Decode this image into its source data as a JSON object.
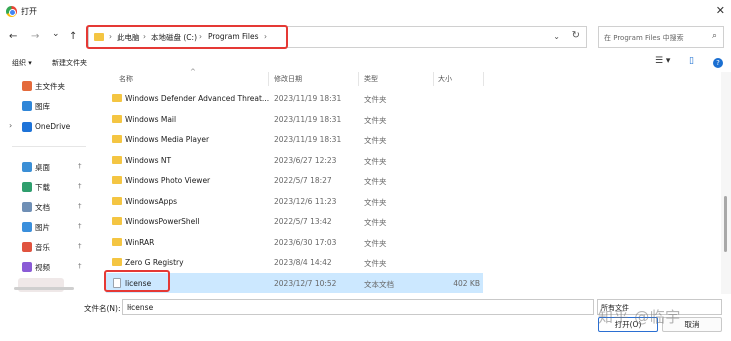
{
  "title_bar": {
    "title": "打开",
    "close_glyph": "✕"
  },
  "nav": {
    "back": "←",
    "forward": "→",
    "recent": "⌄",
    "up": "↑"
  },
  "address": {
    "crumbs": [
      "此电脑",
      "本地磁盘 (C:)",
      "Program Files"
    ],
    "separator": "›",
    "dropdown": "⌄",
    "refresh": "↻",
    "highlight_color": "#e53935"
  },
  "search": {
    "placeholder": "在 Program Files 中搜索",
    "icon": "search-icon"
  },
  "toolbar": {
    "organize": "组织 ▾",
    "new_folder": "新建文件夹",
    "view": "☰ ▾",
    "preview": "▯",
    "help": "?"
  },
  "sidebar": {
    "items": [
      {
        "label": "主文件夹",
        "icon": "home-icon",
        "color": "#e46a3b"
      },
      {
        "label": "图库",
        "icon": "gallery-icon",
        "color": "#2f86d8"
      },
      {
        "label": "OneDrive",
        "icon": "cloud-icon",
        "color": "#1e73d8"
      },
      {
        "label": "桌面",
        "icon": "desktop-icon",
        "color": "#3b8fd6"
      },
      {
        "label": "下载",
        "icon": "download-icon",
        "color": "#2f9e6d"
      },
      {
        "label": "文档",
        "icon": "documents-icon",
        "color": "#6f8fb5"
      },
      {
        "label": "图片",
        "icon": "pictures-icon",
        "color": "#3a8fdc"
      },
      {
        "label": "音乐",
        "icon": "music-icon",
        "color": "#e0533f"
      },
      {
        "label": "视频",
        "icon": "video-icon",
        "color": "#8a5bd6"
      }
    ],
    "pin_glyph": "📌",
    "expand_glyph": "›"
  },
  "columns": {
    "name": "名称",
    "modified": "修改日期",
    "type": "类型",
    "size": "大小",
    "sort_hint": "^"
  },
  "files": [
    {
      "name": "Windows Defender Advanced Threat...",
      "modified": "2023/11/19 18:31",
      "type": "文件夹",
      "size": ""
    },
    {
      "name": "Windows Mail",
      "modified": "2023/11/19 18:31",
      "type": "文件夹",
      "size": ""
    },
    {
      "name": "Windows Media Player",
      "modified": "2023/11/19 18:31",
      "type": "文件夹",
      "size": ""
    },
    {
      "name": "Windows NT",
      "modified": "2023/6/27 12:23",
      "type": "文件夹",
      "size": ""
    },
    {
      "name": "Windows Photo Viewer",
      "modified": "2022/5/7 18:27",
      "type": "文件夹",
      "size": ""
    },
    {
      "name": "WindowsApps",
      "modified": "2023/12/6 11:23",
      "type": "文件夹",
      "size": ""
    },
    {
      "name": "WindowsPowerShell",
      "modified": "2022/5/7 13:42",
      "type": "文件夹",
      "size": ""
    },
    {
      "name": "WinRAR",
      "modified": "2023/6/30 17:03",
      "type": "文件夹",
      "size": ""
    },
    {
      "name": "Zero G Registry",
      "modified": "2023/8/4 14:42",
      "type": "文件夹",
      "size": ""
    },
    {
      "name": "license",
      "modified": "2023/12/7 10:52",
      "type": "文本文档",
      "size": "402 KB",
      "selected": true
    }
  ],
  "bottom": {
    "filename_label": "文件名(N):",
    "filename_value": "license",
    "filter_value": "所有文件",
    "open_label": "打开(O)",
    "cancel_label": "取消",
    "watermark": "知乎 @临宇"
  }
}
